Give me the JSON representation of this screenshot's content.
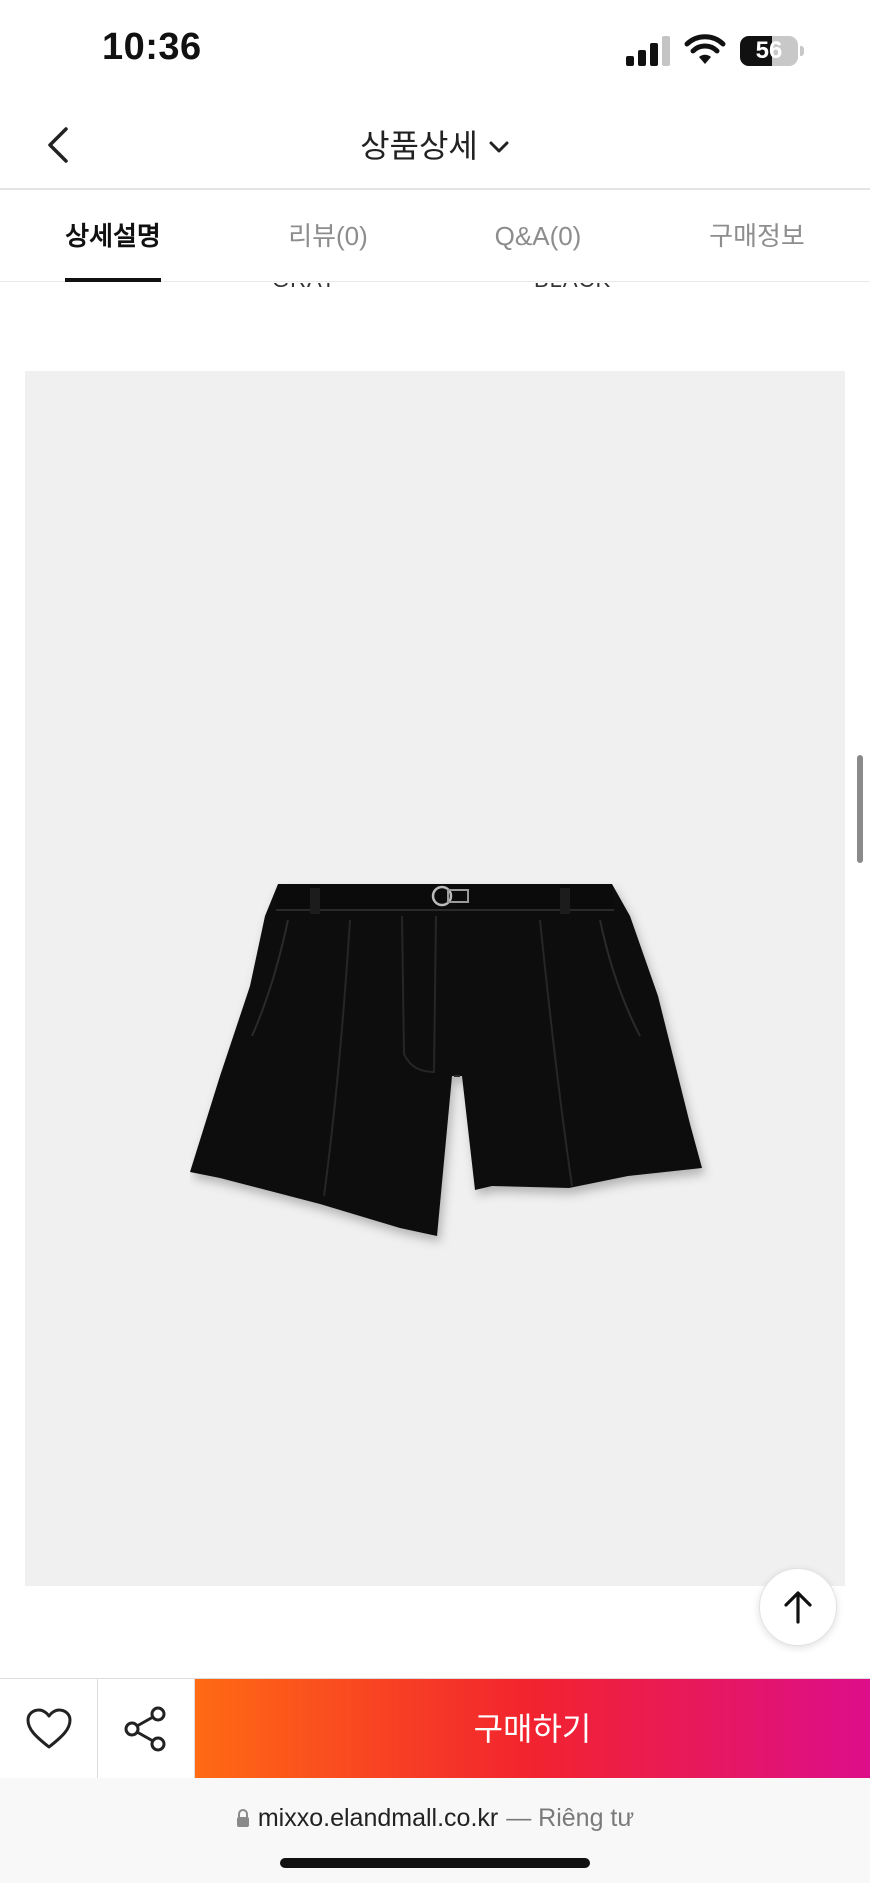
{
  "status_bar": {
    "time": "10:36",
    "battery_level": "56",
    "battery_fraction": 0.56,
    "icons": [
      "signal-icon",
      "wifi-icon",
      "battery-icon"
    ]
  },
  "header": {
    "title": "상품상세",
    "back_icon": "chevron-left-icon",
    "title_dropdown_icon": "chevron-down-icon"
  },
  "tabs": [
    {
      "label": "상세설명",
      "active": true
    },
    {
      "label": "리뷰(0)",
      "active": false
    },
    {
      "label": "Q&A(0)",
      "active": false
    },
    {
      "label": "구매정보",
      "active": false
    }
  ],
  "content": {
    "color_labels": [
      "GRAY",
      "BLACK"
    ],
    "product_image": "black-shorts-image"
  },
  "floating": {
    "scroll_top_icon": "arrow-up-icon"
  },
  "bottom_bar": {
    "wish_icon": "heart-icon",
    "share_icon": "share-icon",
    "buy_label": "구매하기",
    "buy_gradient": [
      "#ff6a13",
      "#f2232f",
      "#dd0e8a"
    ]
  },
  "address_bar": {
    "domain": "mixxo.elandmall.co.kr",
    "privacy": "— Riêng tư",
    "lock_icon": "lock-icon"
  }
}
